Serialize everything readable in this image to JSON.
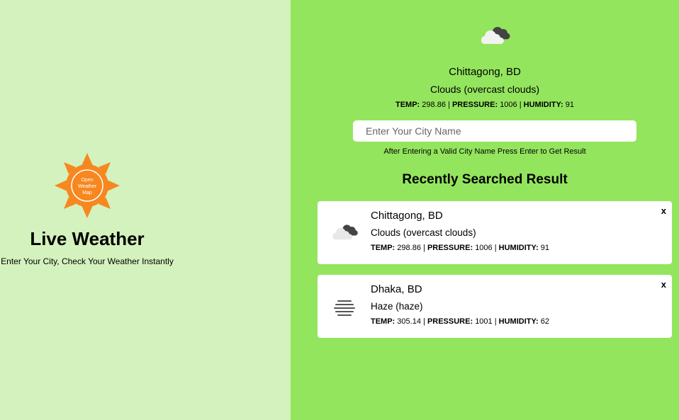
{
  "brand": {
    "title": "Live Weather",
    "tagline": "Enter Your City, Check Your Weather Instantly",
    "logo_text": [
      "Open",
      "Weather",
      "Map"
    ]
  },
  "current": {
    "icon": "broken-clouds-icon",
    "city": "Chittagong, BD",
    "desc": "Clouds (overcast clouds)",
    "temp_label": "TEMP:",
    "temp": "298.86",
    "pressure_label": "PRESSURE:",
    "pressure": "1006",
    "humidity_label": "HUMIDITY:",
    "humidity": "91"
  },
  "search": {
    "placeholder": "Enter Your City Name",
    "hint": "After Entering a Valid City Name Press Enter to Get Result"
  },
  "recent": {
    "title": "Recently Searched Result",
    "items": [
      {
        "icon": "broken-clouds-icon",
        "city": "Chittagong, BD",
        "desc": "Clouds (overcast clouds)",
        "temp": "298.86",
        "pressure": "1006",
        "humidity": "91",
        "close": "x"
      },
      {
        "icon": "haze-icon",
        "city": "Dhaka, BD",
        "desc": "Haze (haze)",
        "temp": "305.14",
        "pressure": "1001",
        "humidity": "62",
        "close": "x"
      }
    ]
  },
  "colors": {
    "left_bg": "#d4f2bd",
    "right_bg": "#94e55e",
    "sun_orange": "#f7871f"
  }
}
